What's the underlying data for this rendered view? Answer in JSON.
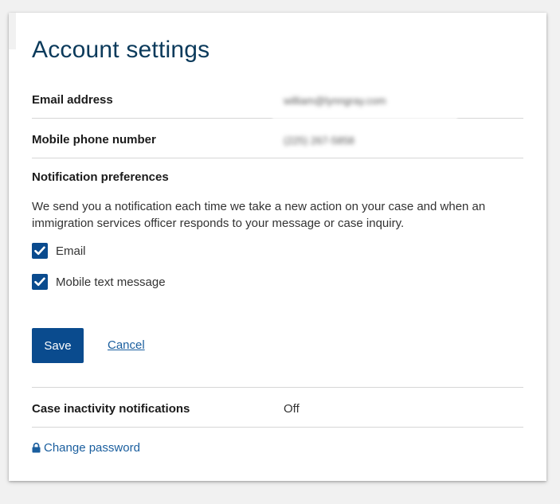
{
  "page": {
    "title": "Account settings"
  },
  "account": {
    "email_label": "Email address",
    "email_value": "william@lynngray.com",
    "phone_label": "Mobile phone number",
    "phone_value": "(225) 267-5858"
  },
  "notifications": {
    "section_title": "Notification preferences",
    "description": "We send you a notification each time we take a new action on your case and when an immigration services officer responds to your message or case inquiry.",
    "options": [
      {
        "label": "Email",
        "checked": true,
        "icon": "check-icon"
      },
      {
        "label": "Mobile text message",
        "checked": true,
        "icon": "check-icon"
      }
    ]
  },
  "actions": {
    "save_label": "Save",
    "cancel_label": "Cancel"
  },
  "inactivity": {
    "label": "Case inactivity notifications",
    "value": "Off"
  },
  "password": {
    "link_label": "Change password",
    "icon": "lock-icon"
  },
  "colors": {
    "primary": "#0a4b8e",
    "title": "#0b3a5b",
    "link": "#1a5e9e",
    "divider": "#d6d6d6",
    "background": "#f1f1f1"
  }
}
